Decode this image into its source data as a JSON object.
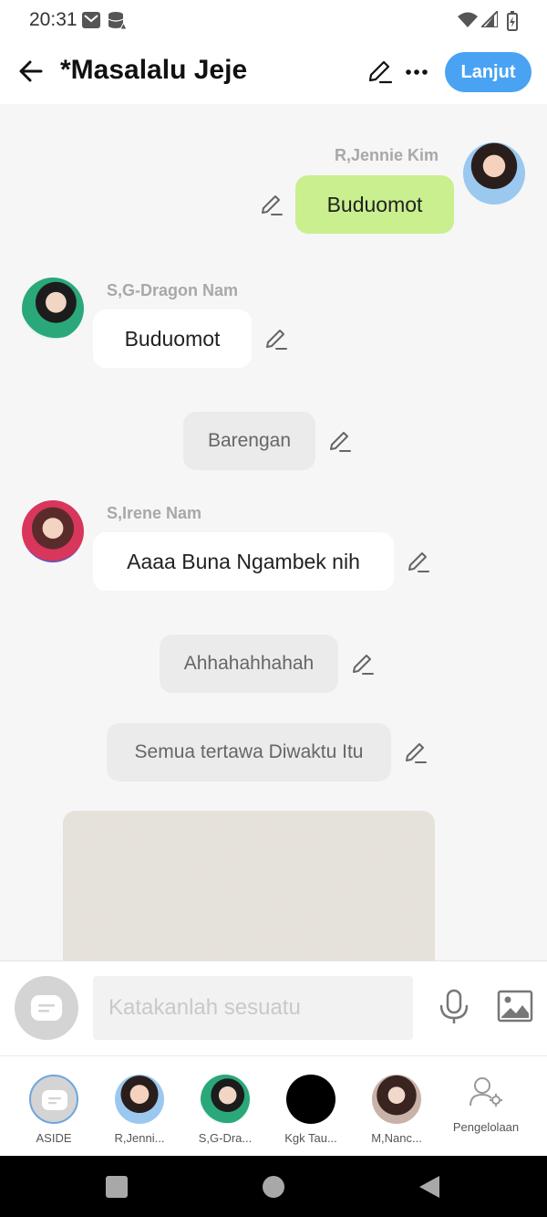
{
  "status_bar": {
    "time": "20:31"
  },
  "header": {
    "title": "*Masalalu Jeje",
    "next_label": "Lanjut"
  },
  "messages": [
    {
      "type": "mine",
      "sender": "R,Jennie Kim",
      "text": "Buduomot"
    },
    {
      "type": "other",
      "sender": "S,G-Dragon Nam",
      "text": "Buduomot"
    },
    {
      "type": "narration",
      "text": "Barengan"
    },
    {
      "type": "other",
      "sender": "S,Irene Nam",
      "text": "Aaaa Buna Ngambek nih"
    },
    {
      "type": "narration",
      "text": "Ahhahahhahah"
    },
    {
      "type": "narration",
      "text": "Semua tertawa Diwaktu Itu"
    },
    {
      "type": "image"
    }
  ],
  "composer": {
    "placeholder": "Katakanlah sesuatu"
  },
  "characters": [
    {
      "label": "ASIDE"
    },
    {
      "label": "R,Jenni..."
    },
    {
      "label": "S,G-Dra..."
    },
    {
      "label": "Kgk Tau..."
    },
    {
      "label": "M,Nanc..."
    },
    {
      "label": "Pengelolaan"
    }
  ],
  "colors": {
    "accent": "#4aa3f2",
    "my_bubble": "#c9ef8e",
    "other_bubble": "#ffffff",
    "narration_bubble": "#ebebeb",
    "sender_name": "#a8a8a8"
  }
}
